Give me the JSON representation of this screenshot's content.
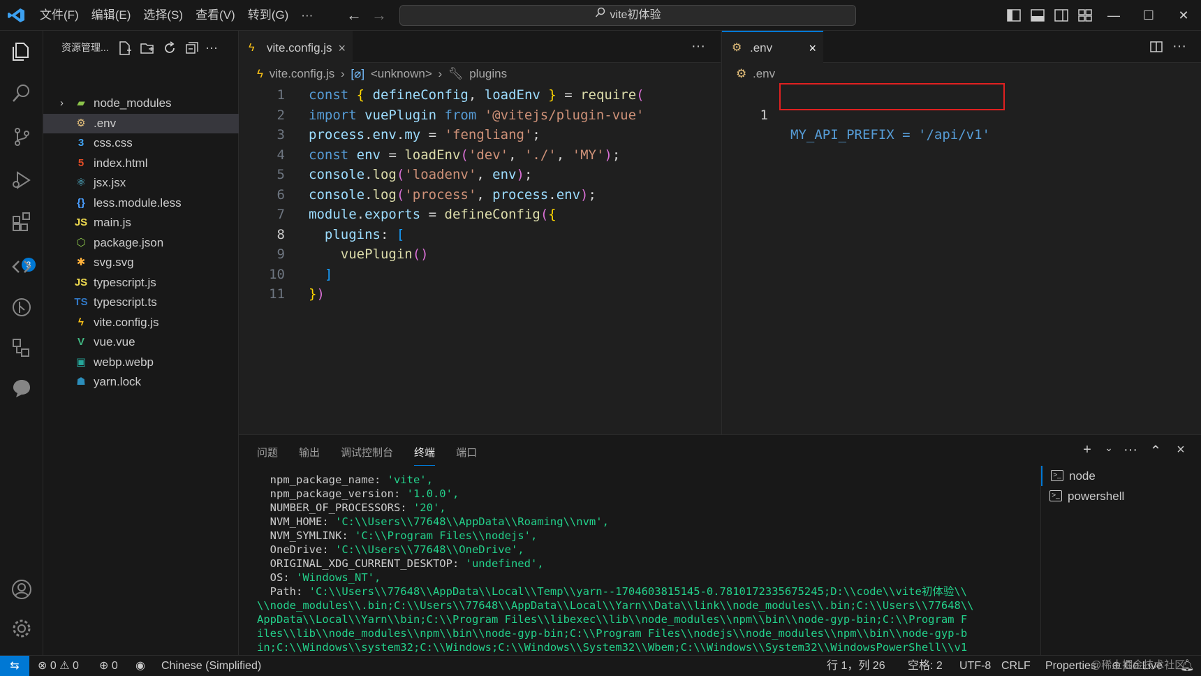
{
  "title_bar": {
    "menus": [
      "文件(F)",
      "编辑(E)",
      "选择(S)",
      "查看(V)",
      "转到(G)",
      "···"
    ],
    "search_text": "vite初体验"
  },
  "activity_bar": {
    "items": [
      "explorer-icon",
      "search-icon",
      "source-control-icon",
      "run-debug-icon",
      "extensions-icon",
      "remote-explorer-icon",
      "git-graph-icon",
      "references-icon",
      "chat-icon"
    ],
    "extensions_badge": "3",
    "bottom": [
      "account-icon",
      "settings-gear-icon"
    ]
  },
  "sidebar": {
    "header": "资源管理...",
    "files": [
      {
        "name": "node_modules",
        "icon": "folder",
        "color": "#8bc34a",
        "glyph": "▰"
      },
      {
        "name": ".env",
        "icon": "env",
        "color": "#e5c07b",
        "glyph": "⚙"
      },
      {
        "name": "css.css",
        "icon": "css",
        "color": "#42a5f5",
        "glyph": "3"
      },
      {
        "name": "index.html",
        "icon": "html",
        "color": "#e44d26",
        "glyph": "5"
      },
      {
        "name": "jsx.jsx",
        "icon": "react",
        "color": "#61dafb",
        "glyph": "⚛"
      },
      {
        "name": "less.module.less",
        "icon": "less",
        "color": "#4a9eff",
        "glyph": "{}"
      },
      {
        "name": "main.js",
        "icon": "js",
        "color": "#f0db4f",
        "glyph": "JS"
      },
      {
        "name": "package.json",
        "icon": "npm",
        "color": "#8bc34a",
        "glyph": "⬡"
      },
      {
        "name": "svg.svg",
        "icon": "svg",
        "color": "#ffb13b",
        "glyph": "✱"
      },
      {
        "name": "typescript.js",
        "icon": "js",
        "color": "#f0db4f",
        "glyph": "JS"
      },
      {
        "name": "typescript.ts",
        "icon": "ts",
        "color": "#3178c6",
        "glyph": "TS"
      },
      {
        "name": "vite.config.js",
        "icon": "vite",
        "color": "#ffc517",
        "glyph": "ϟ"
      },
      {
        "name": "vue.vue",
        "icon": "vue",
        "color": "#41b883",
        "glyph": "V"
      },
      {
        "name": "webp.webp",
        "icon": "image",
        "color": "#26a69a",
        "glyph": "▣"
      },
      {
        "name": "yarn.lock",
        "icon": "yarn",
        "color": "#2c8ebb",
        "glyph": "☗"
      }
    ]
  },
  "editor1": {
    "tab": {
      "name": "vite.config.js",
      "close": "×"
    },
    "more": "···",
    "breadcrumbs": [
      "vite.config.js",
      "<unknown>",
      "plugins"
    ],
    "lines": [
      {
        "n": "1",
        "code": "const { defineConfig, loadEnv } = require("
      },
      {
        "n": "2",
        "code": "import vuePlugin from '@vitejs/plugin-vue'"
      },
      {
        "n": "3",
        "code": "process.env.my = 'fengliang';"
      },
      {
        "n": "4",
        "code": "const env = loadEnv('dev', './', 'MY');"
      },
      {
        "n": "5",
        "code": "console.log('loadenv', env);"
      },
      {
        "n": "6",
        "code": "console.log('process', process.env);"
      },
      {
        "n": "7",
        "code": "module.exports = defineConfig({"
      },
      {
        "n": "8",
        "code": "  plugins: ["
      },
      {
        "n": "9",
        "code": "    vuePlugin()"
      },
      {
        "n": "10",
        "code": "  ]"
      },
      {
        "n": "11",
        "code": "})"
      }
    ]
  },
  "editor2": {
    "tab": {
      "name": ".env",
      "close": "×"
    },
    "more": "···",
    "breadcrumb": ".env",
    "line_number": "1",
    "code": "MY_API_PREFIX = '/api/v1'"
  },
  "panel": {
    "tabs": [
      "问题",
      "输出",
      "调试控制台",
      "终端",
      "端口"
    ],
    "active_tab": "终端",
    "actions": [
      "+",
      "⌄",
      "···",
      "⌃",
      "×"
    ],
    "terminal_lines": [
      {
        "k": "  npm_package_name: ",
        "s": "'vite',"
      },
      {
        "k": "  npm_package_version: ",
        "s": "'1.0.0',"
      },
      {
        "k": "  NUMBER_OF_PROCESSORS: ",
        "s": "'20',"
      },
      {
        "k": "  NVM_HOME: ",
        "s": "'C:\\\\Users\\\\77648\\\\AppData\\\\Roaming\\\\nvm',"
      },
      {
        "k": "  NVM_SYMLINK: ",
        "s": "'C:\\\\Program Files\\\\nodejs',"
      },
      {
        "k": "  OneDrive: ",
        "s": "'C:\\\\Users\\\\77648\\\\OneDrive',"
      },
      {
        "k": "  ORIGINAL_XDG_CURRENT_DESKTOP: ",
        "s": "'undefined',"
      },
      {
        "k": "  OS: ",
        "s": "'Windows_NT',"
      },
      {
        "k": "  Path: ",
        "s": "'C:\\\\Users\\\\77648\\\\AppData\\\\Local\\\\Temp\\\\yarn--1704603815145-0.7810172335675245;D:\\\\code\\\\vite初体验\\\\"
      },
      {
        "k": "",
        "s": "\\\\node_modules\\\\.bin;C:\\\\Users\\\\77648\\\\AppData\\\\Local\\\\Yarn\\\\Data\\\\link\\\\node_modules\\\\.bin;C:\\\\Users\\\\77648\\\\"
      },
      {
        "k": "",
        "s": "AppData\\\\Local\\\\Yarn\\\\bin;C:\\\\Program Files\\\\libexec\\\\lib\\\\node_modules\\\\npm\\\\bin\\\\node-gyp-bin;C:\\\\Program F"
      },
      {
        "k": "",
        "s": "iles\\\\lib\\\\node_modules\\\\npm\\\\bin\\\\node-gyp-bin;C:\\\\Program Files\\\\nodejs\\\\node_modules\\\\npm\\\\bin\\\\node-gyp-b"
      },
      {
        "k": "",
        "s": "in;C:\\\\Windows\\\\system32;C:\\\\Windows;C:\\\\Windows\\\\System32\\\\Wbem;C:\\\\Windows\\\\System32\\\\WindowsPowerShell\\\\v1"
      }
    ],
    "terminals": [
      "node",
      "powershell"
    ]
  },
  "status_bar": {
    "errors": "0",
    "warnings": "0",
    "ports": "0",
    "language_pack": "Chinese (Simplified)",
    "position": "行 1，列 26",
    "spaces": "空格: 2",
    "encoding": "UTF-8",
    "eol": "CRLF",
    "language": "Properties",
    "go_live": "Go Live",
    "watermark": "@稀土掘金技术社区"
  },
  "colors": {
    "accent": "#0078d4",
    "highlight_box": "#e02020",
    "string": "#ce9178",
    "keyword": "#569cd6"
  }
}
